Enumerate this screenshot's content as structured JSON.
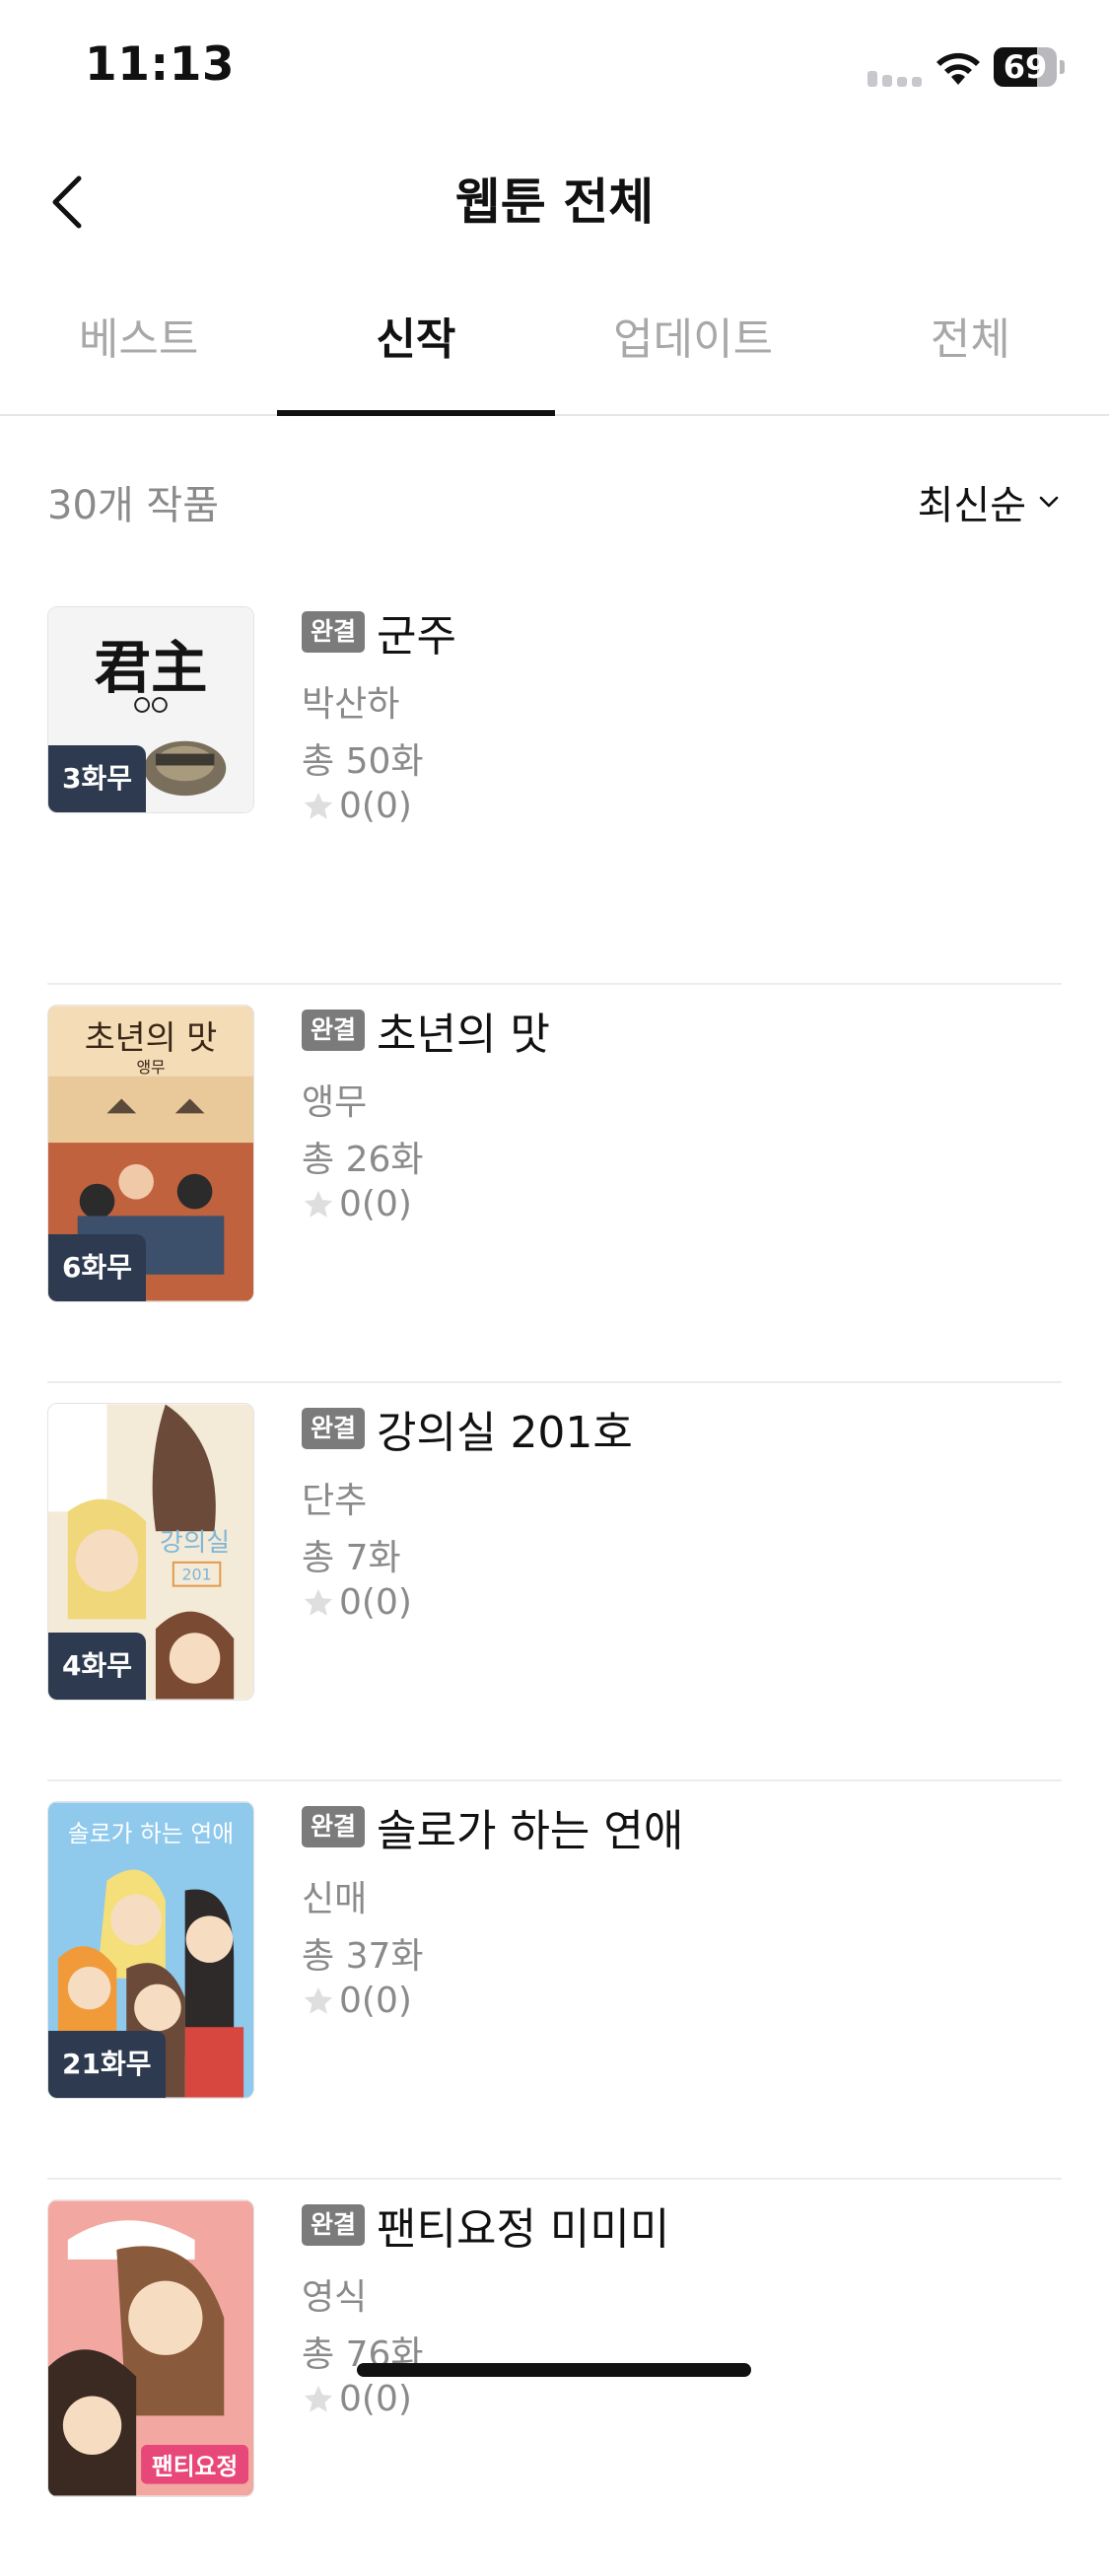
{
  "status_bar": {
    "time": "11:13",
    "battery": "69",
    "battery_level": 0.69
  },
  "header": {
    "title": "웹툰 전체"
  },
  "tabs": [
    {
      "label": "베스트",
      "active": false
    },
    {
      "label": "신작",
      "active": true
    },
    {
      "label": "업데이트",
      "active": false
    },
    {
      "label": "전체",
      "active": false
    }
  ],
  "list_header": {
    "count": "30개 작품",
    "sort": "최신순"
  },
  "items": [
    {
      "status": "완결",
      "title": "군주",
      "author": "박산하",
      "episodes": "총 50화",
      "rating": "0(0)",
      "free_badge": "3화무",
      "cover_text": "君主"
    },
    {
      "status": "완결",
      "title": "초년의 맛",
      "author": "앵무",
      "episodes": "총 26화",
      "rating": "0(0)",
      "free_badge": "6화무",
      "cover_text": "초년의 맛",
      "cover_subtext": "앵무"
    },
    {
      "status": "완결",
      "title": "강의실 201호",
      "author": "단추",
      "episodes": "총 7화",
      "rating": "0(0)",
      "free_badge": "4화무",
      "cover_text": "강의실",
      "cover_subtext": "201"
    },
    {
      "status": "완결",
      "title": "솔로가 하는 연애",
      "author": "신매",
      "episodes": "총 37화",
      "rating": "0(0)",
      "free_badge": "21화무",
      "cover_text": "솔로가 하는 연애"
    },
    {
      "status": "완결",
      "title": "팬티요정 미미미",
      "author": "영식",
      "episodes": "총 76화",
      "rating": "0(0)",
      "cover_text": "팬티요정"
    }
  ],
  "colors": {
    "accent": "#111111",
    "inactive_tab": "#a8a8a8",
    "secondary_text": "#8a8a8a",
    "status_tag": "#7b7b7b",
    "free_badge": "#2d3a4f"
  },
  "icons": [
    "back-arrow-icon",
    "chevron-down-icon",
    "star-icon",
    "wifi-icon",
    "signal-icon",
    "battery-icon"
  ]
}
